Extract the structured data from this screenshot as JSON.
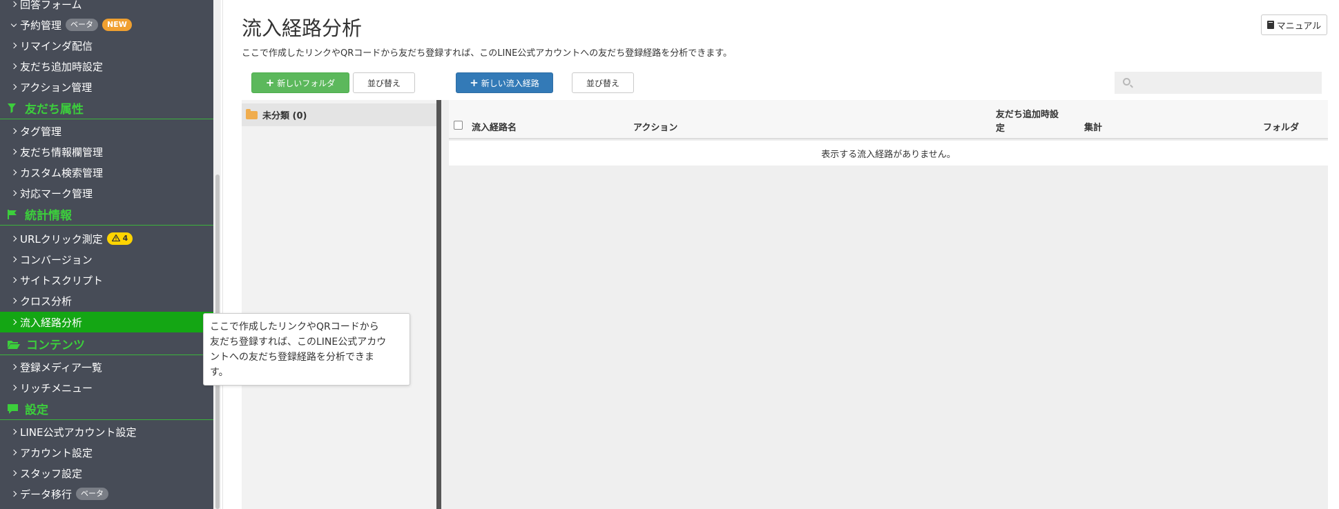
{
  "sidebar": {
    "items": [
      {
        "label": "回答フォーム"
      },
      {
        "label": "予約管理",
        "badges": [
          "ベータ",
          "NEW"
        ]
      },
      {
        "label": "リマインダ配信"
      },
      {
        "label": "友だち追加時設定"
      },
      {
        "label": "アクション管理"
      }
    ],
    "sections": {
      "friend_attr": {
        "title": "友だち属性",
        "items": [
          "タグ管理",
          "友だち情報欄管理",
          "カスタム検索管理",
          "対応マーク管理"
        ]
      },
      "stats": {
        "title": "統計情報",
        "items": [
          "URLクリック測定",
          "コンバージョン",
          "サイトスクリプト",
          "クロス分析",
          "流入経路分析"
        ],
        "url_badge": "4"
      },
      "contents": {
        "title": "コンテンツ",
        "items": [
          "登録メディア一覧",
          "リッチメニュー"
        ]
      },
      "settings": {
        "title": "設定",
        "items": [
          "LINE公式アカウント設定",
          "アカウント設定",
          "スタッフ設定",
          "データ移行"
        ],
        "data_badge": "ベータ"
      }
    },
    "active_item": "流入経路分析",
    "colors": {
      "bg": "#474c57",
      "active": "#14a614",
      "header": "#3ccf3c"
    }
  },
  "main": {
    "title": "流入経路分析",
    "description": "ここで作成したリンクやQRコードから友だち登録すれば、このLINE公式アカウントへの友だち登録経路を分析できます。",
    "manual_label": "マニュアル",
    "new_folder_label": "新しいフォルダ",
    "sort_label": "並び替え",
    "new_route_label": "新しい流入経路",
    "search_placeholder": "",
    "folders": [
      {
        "label": "未分類 (0)"
      }
    ],
    "table": {
      "headers": [
        "流入経路名",
        "アクション",
        "友だち追加時設",
        "定",
        "集計",
        "フォルダ"
      ],
      "empty_message": "表示する流入経路がありません。"
    },
    "tooltip": {
      "lines": [
        "ここで作成したリンクやQRコードから",
        "友だち登録すれば、このLINE公式アカウ",
        "ントへの友だち登録経路を分析できま",
        "す。"
      ]
    }
  }
}
